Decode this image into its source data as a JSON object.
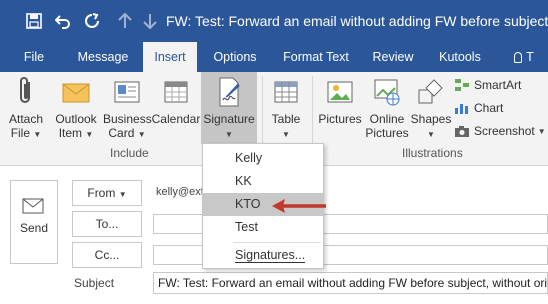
{
  "window": {
    "title": "FW: Test: Forward an email without adding FW before subject, wi"
  },
  "qat": {
    "icons": [
      "save-icon",
      "undo-icon",
      "redo-icon",
      "up-arrow-icon",
      "down-arrow-icon"
    ]
  },
  "tabs": [
    {
      "label": "File"
    },
    {
      "label": "Message"
    },
    {
      "label": "Insert"
    },
    {
      "label": "Options"
    },
    {
      "label": "Format Text"
    },
    {
      "label": "Review"
    },
    {
      "label": "Kutools"
    },
    {
      "label": "T"
    }
  ],
  "ribbon": {
    "attach_file": {
      "line1": "Attach",
      "line2": "File"
    },
    "outlook_item": {
      "line1": "Outlook",
      "line2": "Item"
    },
    "business_card": {
      "line1": "Business",
      "line2": "Card"
    },
    "calendar": {
      "line1": "Calendar"
    },
    "signature": {
      "line1": "Signature"
    },
    "table": {
      "line1": "Table"
    },
    "pictures": {
      "line1": "Pictures"
    },
    "online_pictures": {
      "line1": "Online",
      "line2": "Pictures"
    },
    "shapes": {
      "line1": "Shapes"
    },
    "smartart": "SmartArt",
    "chart": "Chart",
    "screenshot": "Screenshot",
    "group_include": "Include",
    "group_illustrations": "Illustrations"
  },
  "compose": {
    "send": "Send",
    "from": "From",
    "from_value": "kelly@ext",
    "to": "To...",
    "cc": "Cc...",
    "subject_label": "Subject",
    "subject_value": "FW: Test: Forward an email without adding FW before subject, without ori"
  },
  "signature_menu": {
    "items": [
      "Kelly",
      "KK",
      "KTO",
      "Test"
    ],
    "manage": "Signatures...",
    "highlighted": "KTO"
  },
  "colors": {
    "accent": "#2b579a",
    "arrow": "#c0392b"
  }
}
